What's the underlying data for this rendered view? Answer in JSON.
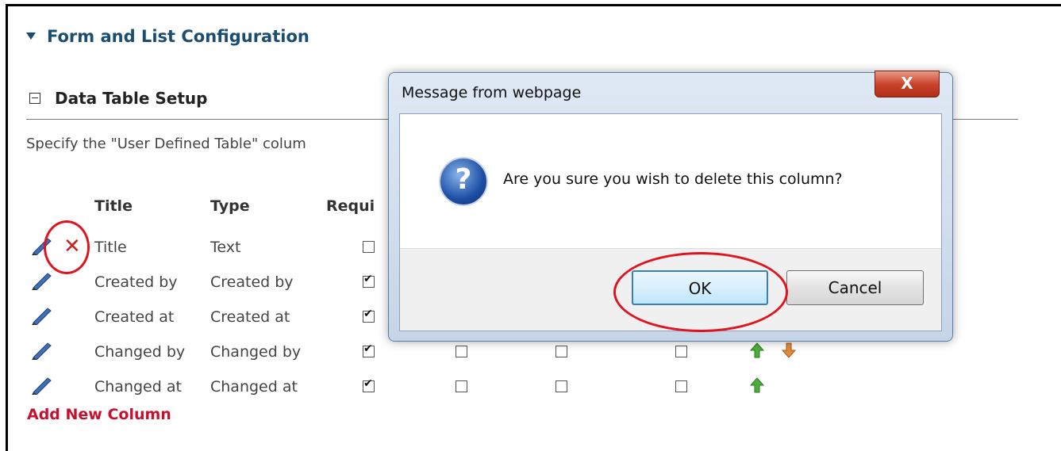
{
  "section": {
    "title": "Form and List Configuration"
  },
  "setup": {
    "title": "Data Table Setup",
    "description": "Specify the \"User Defined Table\" colum"
  },
  "table": {
    "headers": {
      "title": "Title",
      "type": "Type",
      "required": "Requi"
    },
    "rows": [
      {
        "title": "Title",
        "type": "Text",
        "required": false
      },
      {
        "title": "Created by",
        "type": "Created by",
        "required": true
      },
      {
        "title": "Created at",
        "type": "Created at",
        "required": true
      },
      {
        "title": "Changed by",
        "type": "Changed by",
        "required": true
      },
      {
        "title": "Changed at",
        "type": "Changed at",
        "required": true
      }
    ],
    "add_link": "Add New Column"
  },
  "dialog": {
    "title": "Message from webpage",
    "close_label": "X",
    "message": "Are you sure you wish to delete this column?",
    "icon": "question-icon",
    "ok_label": "OK",
    "cancel_label": "Cancel"
  },
  "colors": {
    "heading": "#1a4d73",
    "link": "#c8102e",
    "annotation": "#e0141e"
  }
}
